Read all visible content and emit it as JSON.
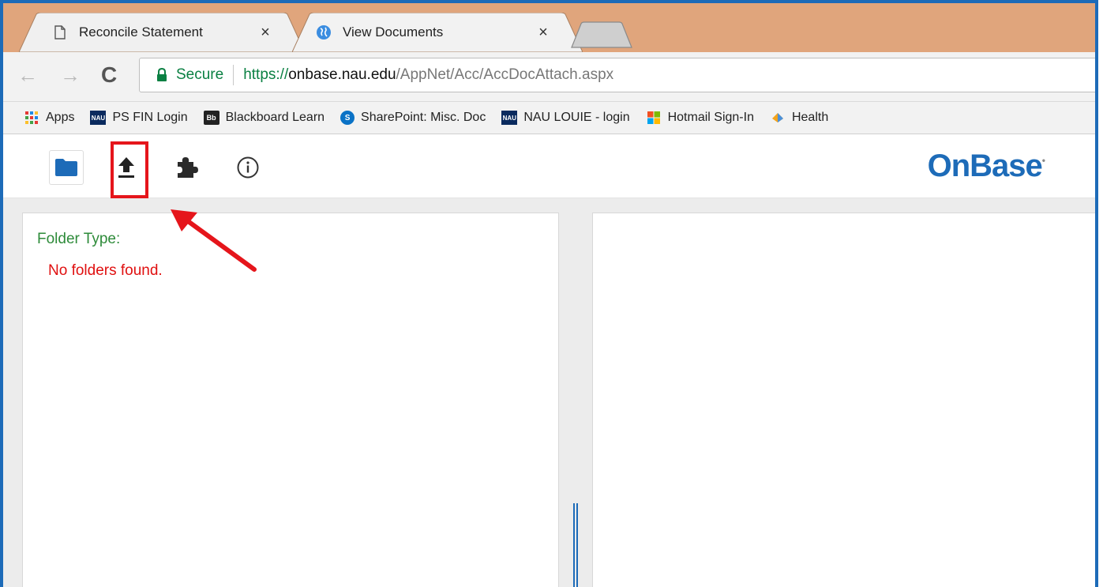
{
  "tabs": [
    {
      "title": "Reconcile Statement",
      "icon": "page-icon",
      "close": "×"
    },
    {
      "title": "View Documents",
      "icon": "globe-icon",
      "close": "×"
    }
  ],
  "toolbar": {
    "back": "←",
    "forward": "→",
    "reload": "C",
    "secure_label": "Secure",
    "url_scheme": "https://",
    "url_host": "onbase.nau.edu",
    "url_path": "/AppNet/Acc/AccDocAttach.aspx"
  },
  "bookmarks": [
    {
      "label": "Apps",
      "icon": "apps-grid-icon"
    },
    {
      "label": "PS FIN Login",
      "icon": "nau-icon",
      "badge": "NAU"
    },
    {
      "label": "Blackboard Learn",
      "icon": "blackboard-icon",
      "badge": "Bb"
    },
    {
      "label": "SharePoint: Misc. Doc",
      "icon": "sharepoint-icon",
      "badge": "S"
    },
    {
      "label": "NAU LOUIE - login",
      "icon": "nau-icon",
      "badge": "NAU"
    },
    {
      "label": "Hotmail Sign-In",
      "icon": "microsoft-icon"
    },
    {
      "label": "Health",
      "icon": "health-icon"
    }
  ],
  "app": {
    "logo": "OnBase",
    "logo_mark": "•",
    "buttons": [
      "folder-icon",
      "upload-icon",
      "puzzle-icon",
      "info-icon"
    ]
  },
  "left_panel": {
    "folder_type_label": "Folder Type:",
    "empty_message": "No folders found."
  },
  "colors": {
    "tabstrip": "#e0a57c",
    "accent": "#1d6bb8",
    "annotation": "#e5151b",
    "label_green": "#2e8b3a",
    "error_red": "#e01010"
  }
}
